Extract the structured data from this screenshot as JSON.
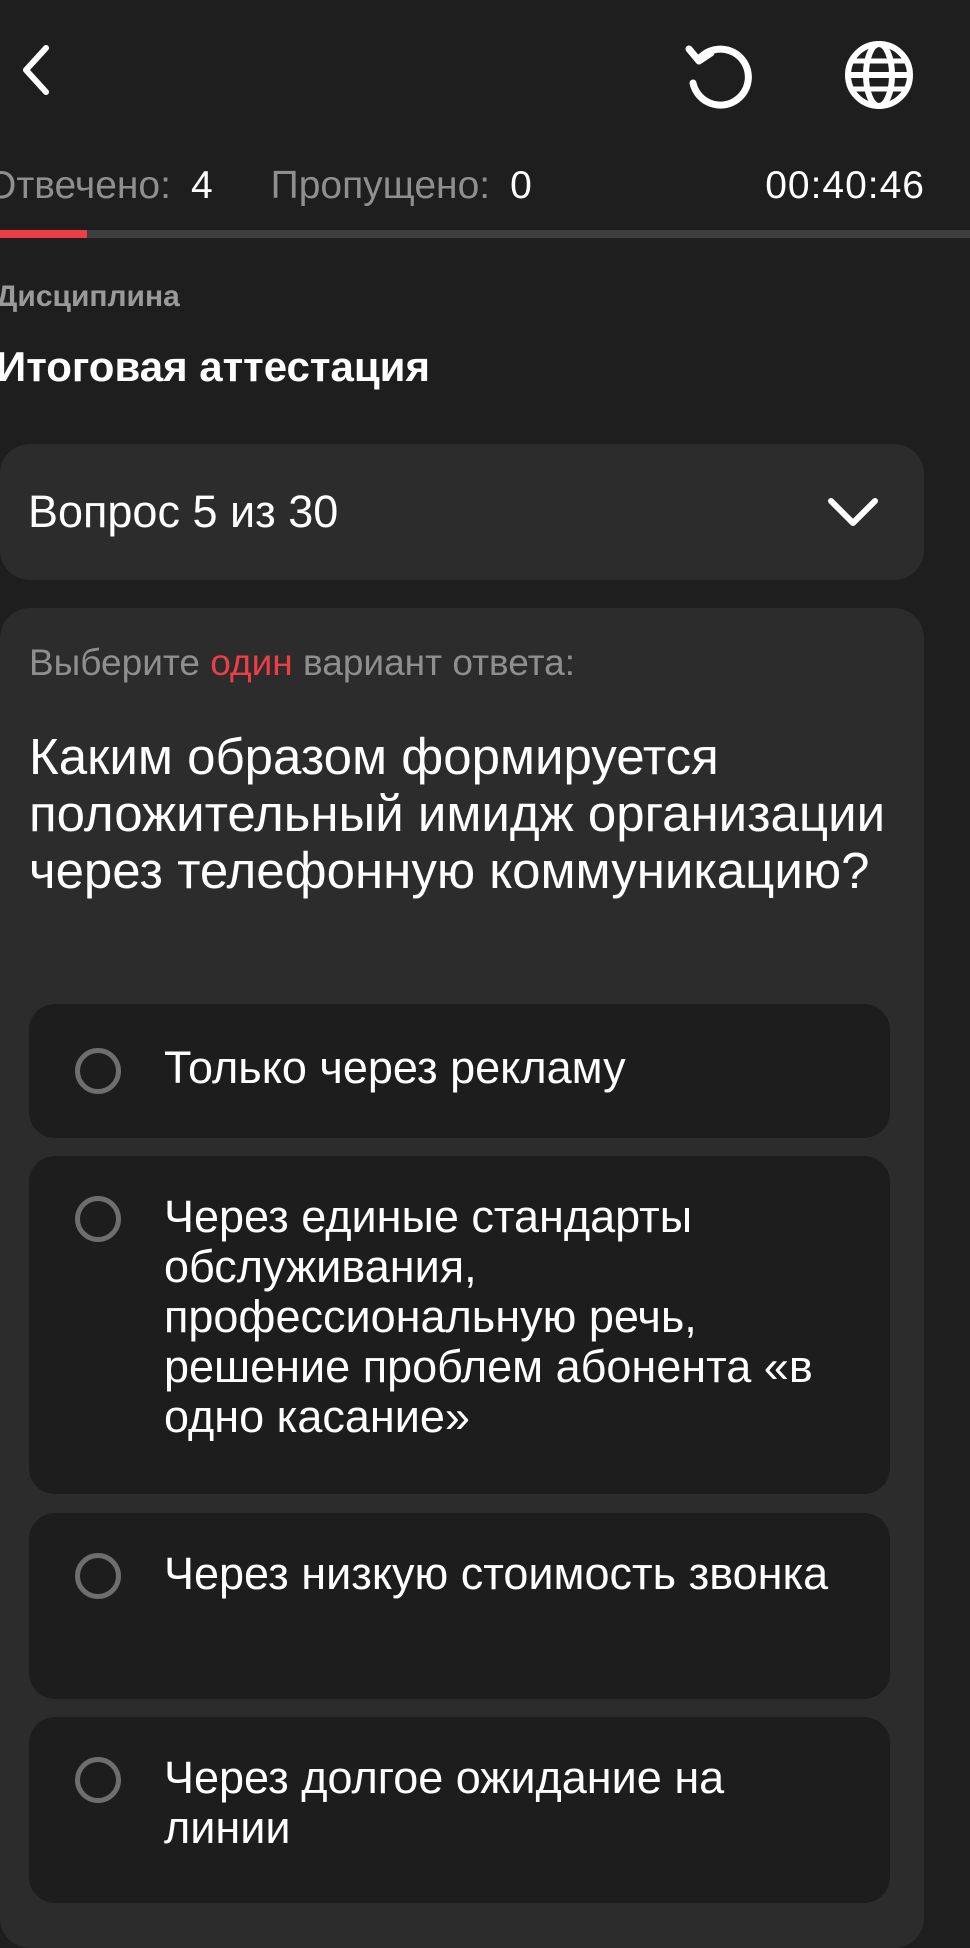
{
  "header": {
    "back_icon": "chevron-left-icon",
    "reset_icon": "reset-icon",
    "language_icon": "globe-icon"
  },
  "stats": {
    "answered_label": "Отвечено:",
    "answered_value": "4",
    "skipped_label": "Пропущено:",
    "skipped_value": "0",
    "timer": "00:40:46"
  },
  "progress": {
    "fraction": 0.09,
    "fill_color": "#ee3e45",
    "track_color": "#3e3e3e"
  },
  "discipline": {
    "label": "Дисциплина",
    "title": "Итоговая аттестация"
  },
  "question_selector": {
    "label": "Вопрос 5 из 30",
    "icon": "chevron-down-icon"
  },
  "question": {
    "instruction_prefix": "Выберите",
    "instruction_accent": "один",
    "instruction_suffix": "вариант ответа:",
    "text": "Каким образом формируется положительный имидж организации через телефонную коммуникацию?",
    "options": [
      {
        "label": "Только через рекламу",
        "selected": false
      },
      {
        "label": "Через единые стандарты обслуживания, профессиональную речь, решение проблем абонента «в одно касание»",
        "selected": false
      },
      {
        "label": "Через низкую стоимость звонка",
        "selected": false
      },
      {
        "label": "Через долгое ожидание на линии",
        "selected": false
      }
    ]
  },
  "colors": {
    "background": "#1e1e1e",
    "card": "#2c2c2c",
    "option": "#1d1d1d",
    "accent": "#ee3e45",
    "muted_text": "#8f8f8f"
  }
}
